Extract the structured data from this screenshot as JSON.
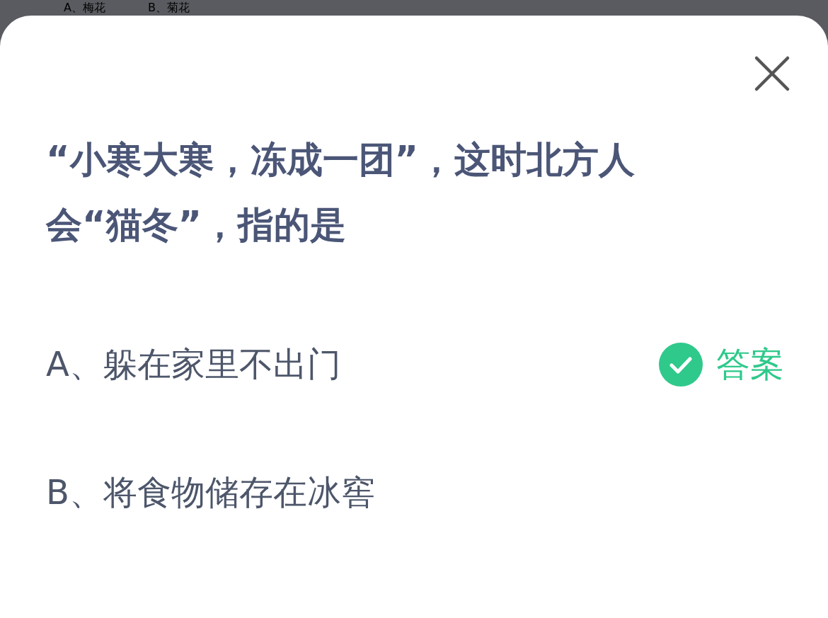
{
  "background_options": [
    "A、梅花",
    "B、菊花"
  ],
  "question": "“小寒大寒，冻成一团”，这时北方人会“猫冬”，指的是",
  "options": [
    {
      "label": "A、躲在家里不出门",
      "correct": true
    },
    {
      "label": "B、将食物储存在冰窖",
      "correct": false
    }
  ],
  "answer_tag": "答案"
}
